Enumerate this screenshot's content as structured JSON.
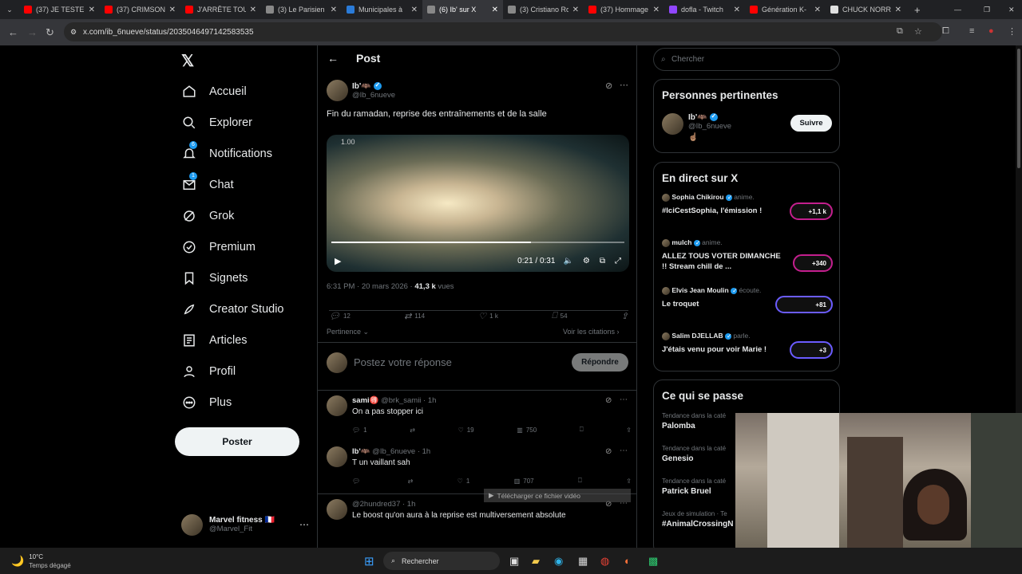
{
  "browser": {
    "tabs": [
      {
        "title": "(37) JE TESTE LE",
        "color": "#ff0000"
      },
      {
        "title": "(37) CRIMSON",
        "color": "#ff0000"
      },
      {
        "title": "J'ARRÊTE TOUT",
        "color": "#ff0000"
      },
      {
        "title": "(3) Le Parisien",
        "color": "#888888"
      },
      {
        "title": "Municipales à",
        "color": "#2a7bd8"
      },
      {
        "title": "(6) Ib' sur X",
        "color": "#888888",
        "active": true
      },
      {
        "title": "(3) Cristiano Ro",
        "color": "#888888"
      },
      {
        "title": "(37) Hommage",
        "color": "#ff0000"
      },
      {
        "title": "dofla - Twitch",
        "color": "#9146ff"
      },
      {
        "title": "Génération K-",
        "color": "#ff0000"
      },
      {
        "title": "CHUCK NORRIS",
        "color": "#e0e0e0"
      }
    ],
    "url": "x.com/ib_6nueve/status/2035046497142583535"
  },
  "sidebar": {
    "items": [
      {
        "label": "Accueil",
        "icon": "home-icon"
      },
      {
        "label": "Explorer",
        "icon": "search-icon"
      },
      {
        "label": "Notifications",
        "icon": "bell-icon",
        "badge": "6"
      },
      {
        "label": "Chat",
        "icon": "mail-icon",
        "badge": "1"
      },
      {
        "label": "Grok",
        "icon": "grok-icon"
      },
      {
        "label": "Premium",
        "icon": "premium-icon"
      },
      {
        "label": "Signets",
        "icon": "bookmark-icon"
      },
      {
        "label": "Creator Studio",
        "icon": "rocket-icon"
      },
      {
        "label": "Articles",
        "icon": "article-icon"
      },
      {
        "label": "Profil",
        "icon": "user-icon"
      },
      {
        "label": "Plus",
        "icon": "more-icon"
      }
    ],
    "post_button": "Poster",
    "account": {
      "name": "Marvel fitness 🇫🇷",
      "handle": "@Marvel_Fit"
    }
  },
  "main": {
    "header": "Post",
    "tweet": {
      "author": "Ib'🦇",
      "handle": "@Ib_6nueve",
      "text": "Fin du ramadan, reprise des entraînements et de la salle",
      "video_time": "0:21 / 0:31",
      "video_overlay": "1.00",
      "timestamp": "6:31 PM · 20 mars 2026 · ",
      "views_count": "41,3 k",
      "views_label": "vues",
      "stats": {
        "replies": "12",
        "reposts": "114",
        "likes": "1 k",
        "bookmarks": "54"
      },
      "sort": "Pertinence",
      "quotes": "Voir les citations"
    },
    "reply_box": {
      "placeholder": "Postez votre réponse",
      "button": "Répondre"
    },
    "replies": [
      {
        "name": "sami🉐",
        "handle": "@brk_samii · 1h",
        "text": "On a pas stopper ici",
        "replies": "1",
        "likes": "19",
        "views": "750"
      },
      {
        "name": "Ib'🦇",
        "handle": "@Ib_6nueve · 1h",
        "text": "T un vaillant sah",
        "replies": "",
        "likes": "1",
        "views": "707"
      },
      {
        "name": "",
        "handle": "@2hundred37 · 1h",
        "text": "Le boost qu'on aura à la reprise est multiversement absolute"
      }
    ],
    "download_hint": "Télécharger ce fichier vidéo"
  },
  "right": {
    "search_placeholder": "Chercher",
    "relevant": {
      "title": "Personnes pertinentes",
      "name": "Ib'🦇",
      "handle": "@Ib_6nueve",
      "emoji": "☝🏽",
      "follow": "Suivre"
    },
    "live": {
      "title": "En direct sur X",
      "items": [
        {
          "host": "Sophia Chikirou",
          "role": "anime.",
          "title": "#IciCestSophia, l'émission !",
          "count": "+1,1 k"
        },
        {
          "host": "mulch",
          "role": "anime.",
          "title": "ALLEZ TOUS VOTER DIMANCHE !! Stream chill de ...",
          "count": "+340"
        },
        {
          "host": "Elvis Jean Moulin",
          "role": "écoute.",
          "title": "Le troquet",
          "count": "+81"
        },
        {
          "host": "Salim DJELLAB",
          "role": "parle.",
          "title": "J'étais venu pour voir Marie !",
          "count": "+3"
        }
      ]
    },
    "trends": {
      "title": "Ce qui se passe",
      "items": [
        {
          "context": "Tendance dans la caté",
          "name": "Palomba"
        },
        {
          "context": "Tendance dans la caté",
          "name": "Genesio"
        },
        {
          "context": "Tendance dans la caté",
          "name": "Patrick Bruel"
        },
        {
          "context": "Jeux de simulation · Te",
          "name": "#AnimalCrossingN"
        }
      ]
    }
  },
  "taskbar": {
    "weather_temp": "10°C",
    "weather_desc": "Temps dégagé",
    "search": "Rechercher"
  }
}
